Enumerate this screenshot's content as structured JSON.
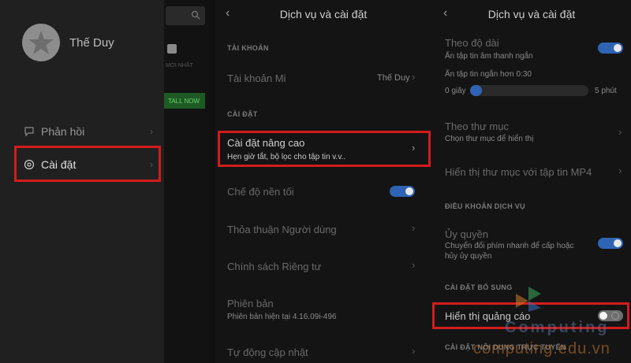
{
  "drawer": {
    "user_name": "Thế Duy",
    "items": [
      {
        "label": "Phản hồi",
        "icon": "feedback-icon"
      },
      {
        "label": "Cài đặt",
        "icon": "settings-icon"
      }
    ],
    "behind": {
      "button_text": "TALL NOW",
      "small_text": "MỚI NHẤT"
    }
  },
  "panel2": {
    "title": "Dịch vụ và cài đặt",
    "section_account": "TÀI KHOẢN",
    "account_label": "Tài khoản Mi",
    "account_value": "Thế Duy",
    "section_settings": "CÀI ĐẶT",
    "advanced_title": "Cài đặt nâng cao",
    "advanced_sub": "Hẹn giờ tắt, bộ lọc cho tập tin v.v..",
    "dark_mode": "Chế độ nền tối",
    "user_agreement": "Thỏa thuận Người dùng",
    "privacy": "Chính sách Riêng tư",
    "version_title": "Phiên bản",
    "version_sub": "Phiên bản hiện tại 4.16.09i-496",
    "auto_update": "Tự động cập nhật"
  },
  "panel3": {
    "title": "Dịch vụ và cài đặt",
    "by_length_title": "Theo độ dài",
    "by_length_sub": "Ẩn tập tin âm thanh ngắn",
    "hide_shorter": "Ẩn tập tin ngắn hơn 0:30",
    "slider_min": "0 giây",
    "slider_max": "5 phút",
    "slider_value_fraction": 0.1,
    "by_folder_title": "Theo thư mục",
    "by_folder_sub": "Chọn thư mục để hiển thị",
    "show_mp4": "Hiển thị thư mục với tập tin MP4",
    "section_terms": "ĐIỀU KHOẢN DỊCH VỤ",
    "auth_title": "Ủy quyền",
    "auth_sub1": "Chuyển đổi phím nhanh để cấp hoặc",
    "auth_sub2": "hủy ủy quyền",
    "section_extra": "CÀI ĐẶT BỔ SUNG",
    "show_ads": "Hiển thị quảng cáo",
    "section_online": "CÀI ĐẶT NỘI DUNG TRỰC TUYẾN"
  },
  "watermark": {
    "brand": "Computing",
    "site": "computing.edu.vn"
  },
  "colors": {
    "accent": "#2f64b4",
    "highlight": "#d21c1c",
    "background": "#141414"
  }
}
